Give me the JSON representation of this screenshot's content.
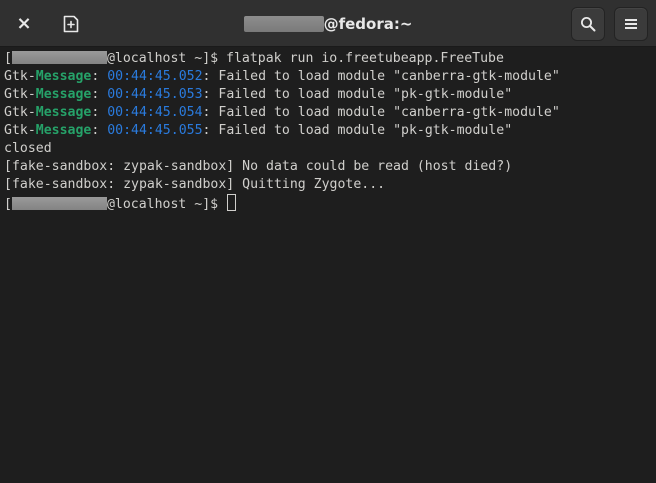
{
  "window": {
    "title_suffix": "@fedora:~",
    "close_label": "×"
  },
  "colors": {
    "headerbar": "#303030",
    "terminal_bg": "#1e1e1e",
    "text": "#d0cfcc",
    "message_green": "#26a269",
    "timestamp_blue": "#2a7bde"
  },
  "icons": {
    "close": "close-icon",
    "new_tab": "new-tab-icon",
    "search": "search-icon",
    "menu": "hamburger-menu-icon"
  },
  "terminal": {
    "prompt_open": "[",
    "prompt_host": "@localhost ~]$ ",
    "command": "flatpak run io.freetubeapp.FreeTube",
    "messages": [
      {
        "prefix": "Gtk-",
        "tag": "Message",
        "sep": ": ",
        "time": "00:44:45.052",
        "text": ": Failed to load module \"canberra-gtk-module\""
      },
      {
        "prefix": "Gtk-",
        "tag": "Message",
        "sep": ": ",
        "time": "00:44:45.053",
        "text": ": Failed to load module \"pk-gtk-module\""
      },
      {
        "prefix": "Gtk-",
        "tag": "Message",
        "sep": ": ",
        "time": "00:44:45.054",
        "text": ": Failed to load module \"canberra-gtk-module\""
      },
      {
        "prefix": "Gtk-",
        "tag": "Message",
        "sep": ": ",
        "time": "00:44:45.055",
        "text": ": Failed to load module \"pk-gtk-module\""
      }
    ],
    "closed": "closed",
    "sandbox_1": "[fake-sandbox: zypak-sandbox] No data could be read (host died?)",
    "sandbox_2": "[fake-sandbox: zypak-sandbox] Quitting Zygote..."
  }
}
